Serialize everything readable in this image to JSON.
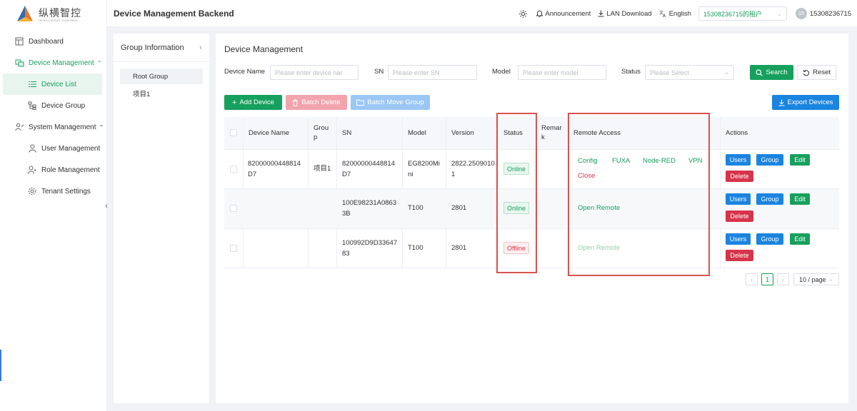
{
  "brand": {
    "name_cn": "纵横智控",
    "name_en": "INTELLIGENT CONTROL"
  },
  "header": {
    "title": "Device Management Backend",
    "announcement": "Announcement",
    "lan_download": "LAN Download",
    "language": "English",
    "tenant": "15308236715的租户",
    "avatar_initials": "15",
    "username": "15308236715"
  },
  "sidebar": {
    "dashboard": "Dashboard",
    "device_management": "Device Management",
    "device_list": "Device List",
    "device_group": "Device Group",
    "system_management": "System Management",
    "user_management": "User Management",
    "role_management": "Role Management",
    "tenant_settings": "Tenant Settings"
  },
  "group_panel": {
    "title": "Group Information",
    "items": [
      "Root Group",
      "项目1"
    ]
  },
  "main": {
    "title": "Device Management",
    "filters": {
      "device_name_label": "Device Name",
      "device_name_placeholder": "Please enter device nar",
      "sn_label": "SN",
      "sn_placeholder": "Please enter SN",
      "model_label": "Model",
      "model_placeholder": "Please enter model",
      "status_label": "Status",
      "status_placeholder": "Please Select"
    },
    "search_label": "Search",
    "reset_label": "Reset",
    "add_device": "Add Device",
    "batch_delete": "Batch Delete",
    "batch_move_group": "Batch Move Group",
    "export_devices": "Export Devices"
  },
  "table": {
    "columns": {
      "device_name": "Device Name",
      "group": "Grou p",
      "sn": "SN",
      "model": "Model",
      "version": "Version",
      "status": "Status",
      "remark": "Remar k",
      "remote_access": "Remote Access",
      "actions": "Actions"
    },
    "rows": [
      {
        "device_name": "82000000448814D7",
        "group": "项目1",
        "sn": "82000000448814D7",
        "model": "EG8200Mini",
        "version": "2822.25090101",
        "status": "Online",
        "remote_links": [
          "Config",
          "FUXA",
          "Node-RED",
          "VPN",
          "Close"
        ]
      },
      {
        "device_name": "",
        "group": "",
        "sn": "100E98231A08633B",
        "model": "T100",
        "version": "2801",
        "status": "Online",
        "remote_links": [
          "Open Remote"
        ]
      },
      {
        "device_name": "",
        "group": "",
        "sn": "100992D9D3364783",
        "model": "T100",
        "version": "2801",
        "status": "Offline",
        "remote_links": [
          "Open Remote"
        ]
      }
    ],
    "action_labels": {
      "users": "Users",
      "group": "Group",
      "edit": "Edit",
      "delete": "Delete"
    }
  },
  "pagination": {
    "current_page": "1",
    "page_size": "10 / page"
  }
}
